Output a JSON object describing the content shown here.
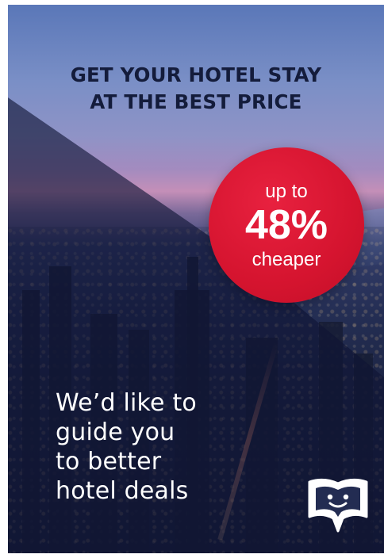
{
  "headline": {
    "line1": "GET YOUR HOTEL STAY",
    "line2": "AT THE BEST PRICE"
  },
  "badge": {
    "prefix": "up to",
    "value": "48%",
    "suffix": "cheaper"
  },
  "tagline": {
    "line1": "We’d like to",
    "line2": "guide you",
    "line3": "to better",
    "line4": "hotel deals"
  },
  "logo": {
    "icon": "open-book-face-speech-bubble-icon"
  },
  "colors": {
    "headline": "#141c3b",
    "badge": "#d5142f",
    "text_light": "#ffffff"
  }
}
